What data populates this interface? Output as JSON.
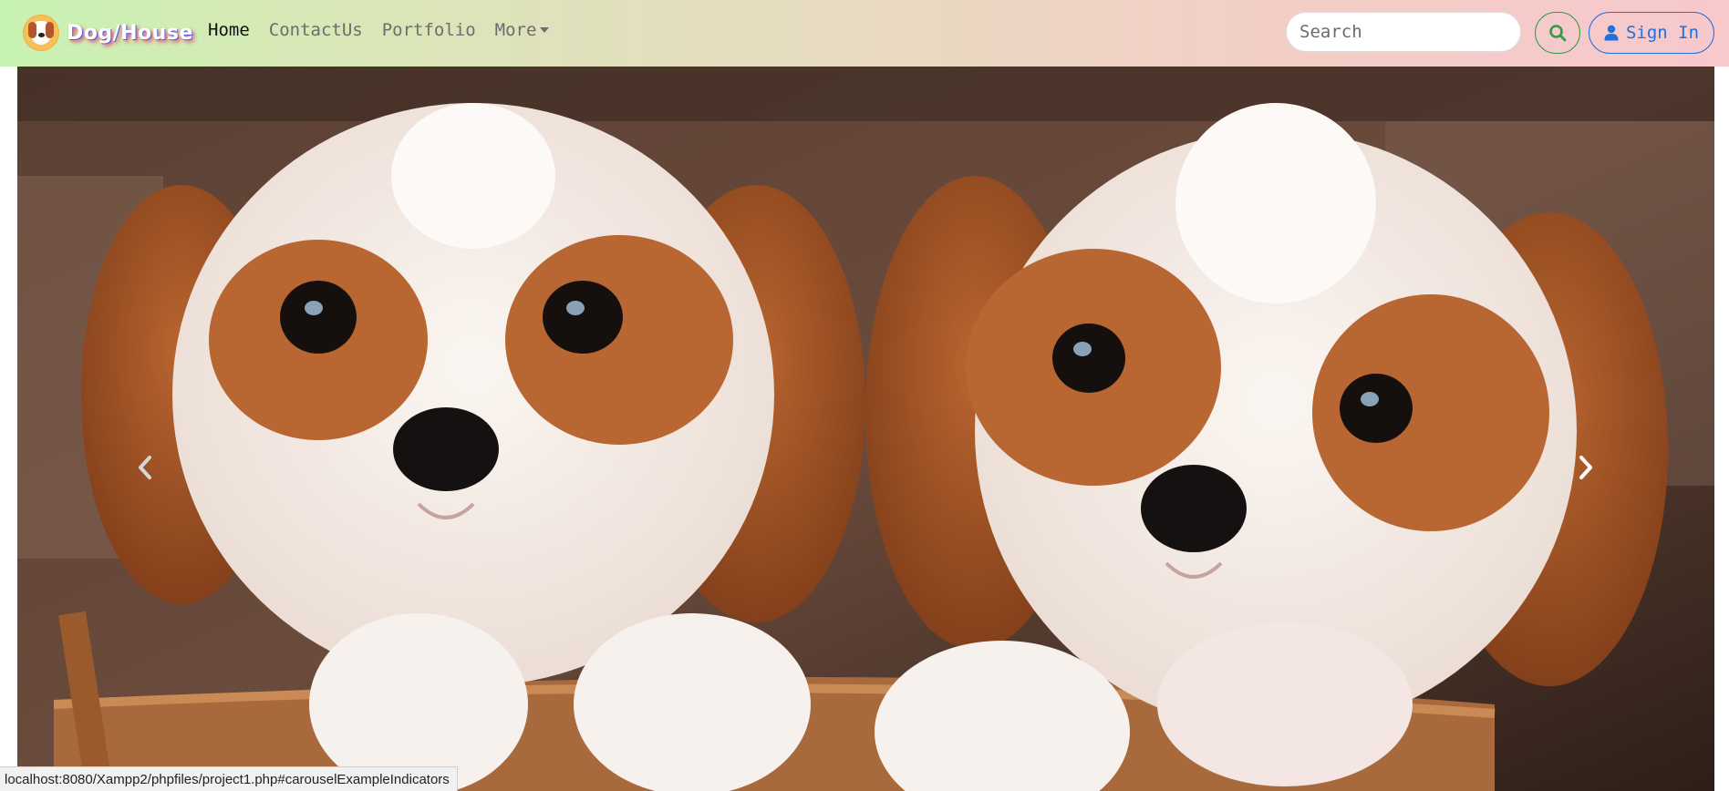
{
  "brand": {
    "name": "Dog/House"
  },
  "nav": {
    "links": [
      {
        "label": "Home",
        "active": true
      },
      {
        "label": "ContactUs"
      },
      {
        "label": "Portfolio"
      },
      {
        "label": "More",
        "dropdown": true
      }
    ]
  },
  "search": {
    "placeholder": "Search",
    "value": "",
    "button_icon": "search-icon"
  },
  "signin": {
    "label": "Sign In",
    "icon": "user-icon"
  },
  "carousel": {
    "image": "two puppies in a basket",
    "prev_icon": "chevron-left-icon",
    "next_icon": "chevron-right-icon"
  },
  "status_bar": {
    "url": "localhost:8080/Xampp2/phpfiles/project1.php#carouselExampleIndicators"
  },
  "colors": {
    "navbar_gradient_start": "#c8f2b2",
    "navbar_gradient_end": "#f7c8cc",
    "search_button": "#2f9b45",
    "signin_button": "#1f6fe0"
  }
}
